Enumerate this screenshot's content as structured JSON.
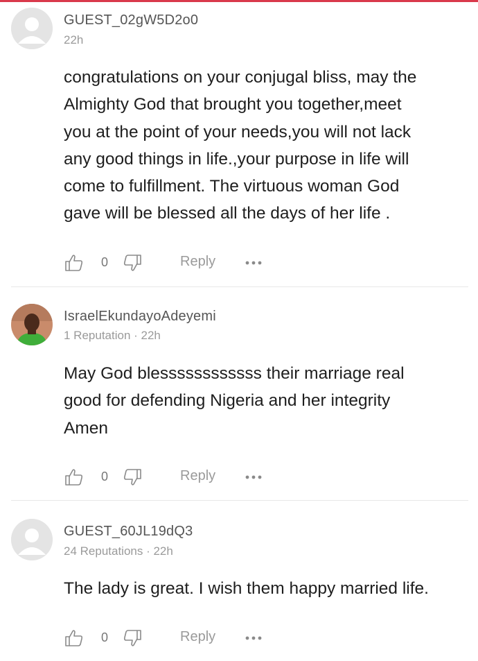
{
  "comments": [
    {
      "username": "GUEST_02gW5D2o0",
      "meta": "22h",
      "avatar": "default-avatar",
      "lines": [
        "congratulations on your  conjugal bliss, may the",
        "Almighty  God  that brought you together,meet",
        "you at the point of your needs,you will not lack",
        "any good things in life.,your purpose  in life will",
        "come to fulfillment. The virtuous  woman God",
        "gave will be blessed all the days of her life ."
      ],
      "like_count": "0",
      "reply_label": "Reply"
    },
    {
      "username": "IsraelEkundayoAdeyemi",
      "meta": "1 Reputation · 22h",
      "avatar": "profile-photo",
      "lines": [
        "May God blessssssssssss their marriage real",
        "good for defending Nigeria and her  integrity",
        "Amen"
      ],
      "like_count": "0",
      "reply_label": "Reply"
    },
    {
      "username": "GUEST_60JL19dQ3",
      "meta": "24 Reputations · 22h",
      "avatar": "default-avatar",
      "lines": [
        "The lady is great. I wish them happy married life."
      ],
      "like_count": "0",
      "reply_label": "Reply"
    }
  ],
  "colors": {
    "accent": "#d9394b",
    "divider": "#e8e8e8",
    "muted": "#9a9a9a"
  },
  "icons": [
    "thumbs-up-icon",
    "thumbs-down-icon",
    "more-icon"
  ]
}
